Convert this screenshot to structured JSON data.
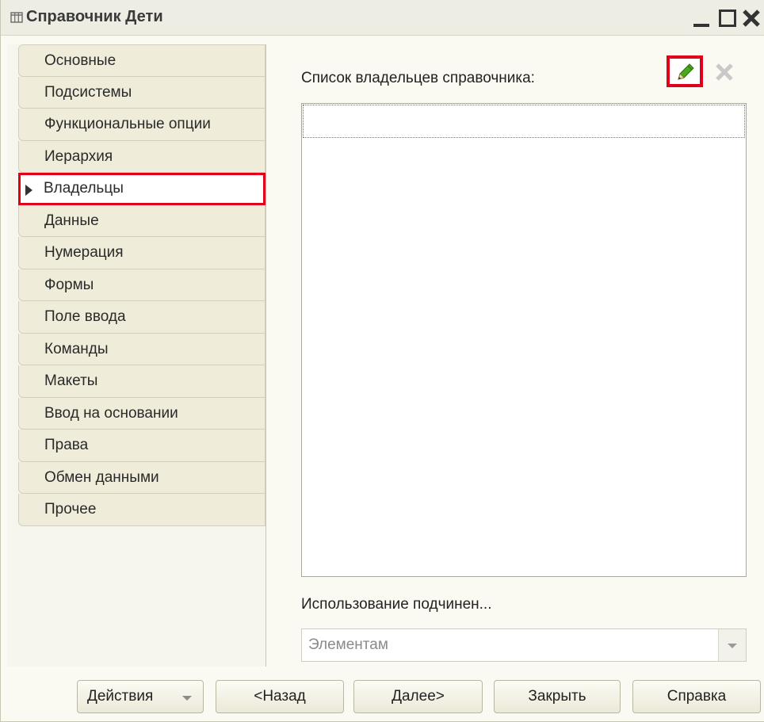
{
  "window": {
    "title": "Справочник Дети"
  },
  "icons": {
    "title": "table-icon",
    "edit": "pencil-icon",
    "delete": "close-x-icon"
  },
  "colors": {
    "highlight": "#e0001a",
    "tab_bg": "#efecd9"
  },
  "nav": {
    "items": [
      "Основные",
      "Подсистемы",
      "Функциональные опции",
      "Иерархия",
      "Владельцы",
      "Данные",
      "Нумерация",
      "Формы",
      "Поле ввода",
      "Команды",
      "Макеты",
      "Ввод на основании",
      "Права",
      "Обмен данными",
      "Прочее"
    ],
    "active": "Владельцы"
  },
  "owners": {
    "label": "Список владельцев справочника:",
    "items": []
  },
  "subordination": {
    "label": "Использование подчинен...",
    "value": "Элементам"
  },
  "buttons": {
    "actions": "Действия",
    "back": "<Назад",
    "next": "Далее>",
    "close": "Закрыть",
    "help": "Справка"
  }
}
